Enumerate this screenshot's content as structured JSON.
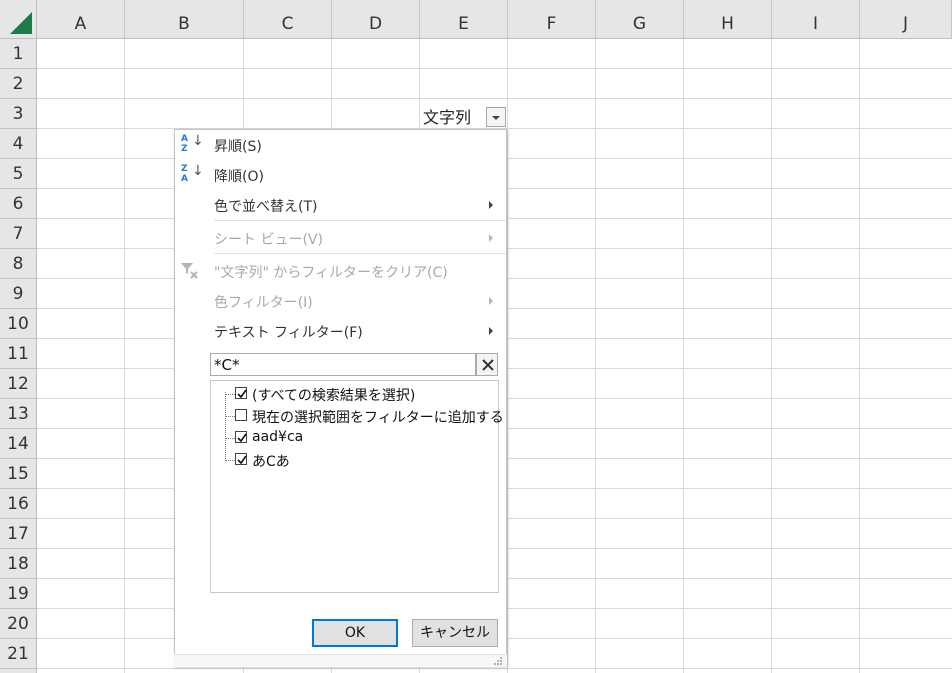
{
  "columns": [
    "A",
    "B",
    "C",
    "D",
    "E",
    "F",
    "G",
    "H",
    "I",
    "J"
  ],
  "rows": [
    "1",
    "2",
    "3",
    "4",
    "5",
    "6",
    "7",
    "8",
    "9",
    "10",
    "11",
    "12",
    "13",
    "14",
    "15",
    "16",
    "17",
    "18",
    "19",
    "20",
    "21"
  ],
  "cell_e3": "文字列",
  "menu": {
    "sort_asc": "昇順(S)",
    "sort_desc": "降順(O)",
    "sort_by_color": "色で並べ替え(T)",
    "sheet_view": "シート ビュー(V)",
    "clear_filter": "\"文字列\" からフィルターをクリア(C)",
    "color_filter": "色フィルター(I)",
    "text_filter": "テキスト フィルター(F)"
  },
  "search": {
    "value": "*C*"
  },
  "list_items": [
    {
      "label": "(すべての検索結果を選択)",
      "checked": true
    },
    {
      "label": "現在の選択範囲をフィルターに追加する",
      "checked": false
    },
    {
      "label": "aad¥ca",
      "checked": true
    },
    {
      "label": "あCあ",
      "checked": true
    }
  ],
  "buttons": {
    "ok": "OK",
    "cancel": "キャンセル"
  },
  "colors": {
    "accent": "#0078d7",
    "corner": "#1d7a4a",
    "sort_icon": "#2a78c8"
  }
}
